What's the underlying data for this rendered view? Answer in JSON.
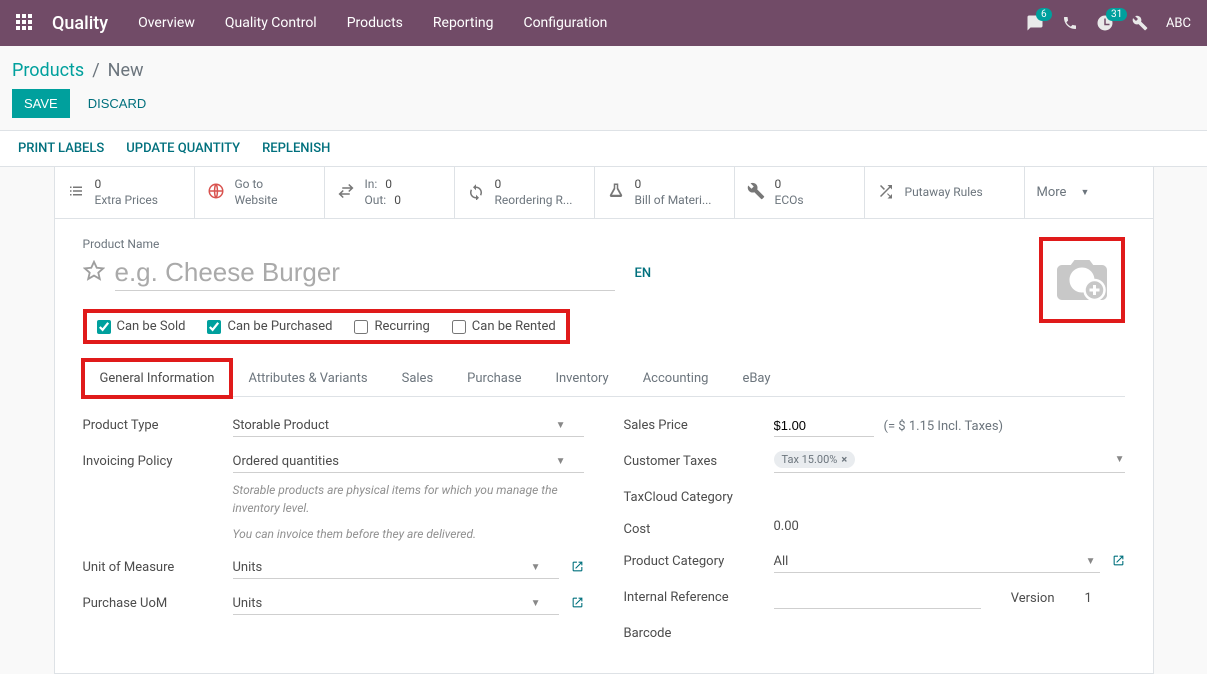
{
  "nav": {
    "brand": "Quality",
    "menu": [
      "Overview",
      "Quality Control",
      "Products",
      "Reporting",
      "Configuration"
    ],
    "chat_badge": "6",
    "clock_badge": "31",
    "user": "ABC"
  },
  "breadcrumb": {
    "parent": "Products",
    "current": "New"
  },
  "actions": {
    "save": "SAVE",
    "discard": "DISCARD"
  },
  "subactions": [
    "PRINT LABELS",
    "UPDATE QUANTITY",
    "REPLENISH"
  ],
  "stats": {
    "extra_prices": {
      "count": "0",
      "label": "Extra Prices"
    },
    "website": {
      "line1": "Go to",
      "line2": "Website"
    },
    "inout": {
      "in_label": "In:",
      "in_val": "0",
      "out_label": "Out:",
      "out_val": "0"
    },
    "reordering": {
      "count": "0",
      "label": "Reordering R..."
    },
    "bom": {
      "count": "0",
      "label": "Bill of Materi..."
    },
    "ecos": {
      "count": "0",
      "label": "ECOs"
    },
    "putaway": {
      "label": "Putaway Rules"
    },
    "more": "More"
  },
  "form": {
    "product_name_label": "Product Name",
    "product_name_placeholder": "e.g. Cheese Burger",
    "lang": "EN",
    "checks": {
      "sold": "Can be Sold",
      "purchased": "Can be Purchased",
      "recurring": "Recurring",
      "rented": "Can be Rented"
    },
    "tabs": [
      "General Information",
      "Attributes & Variants",
      "Sales",
      "Purchase",
      "Inventory",
      "Accounting",
      "eBay"
    ],
    "left": {
      "product_type_label": "Product Type",
      "product_type_value": "Storable Product",
      "invoicing_label": "Invoicing Policy",
      "invoicing_value": "Ordered quantities",
      "helper1": "Storable products are physical items for which you manage the inventory level.",
      "helper2": "You can invoice them before they are delivered.",
      "uom_label": "Unit of Measure",
      "uom_value": "Units",
      "puom_label": "Purchase UoM",
      "puom_value": "Units"
    },
    "right": {
      "sales_price_label": "Sales Price",
      "sales_price_value": "$1.00",
      "incl_taxes": "(= $ 1.15 Incl. Taxes)",
      "cust_taxes_label": "Customer Taxes",
      "tax_tag": "Tax 15.00%",
      "taxcloud_label": "TaxCloud Category",
      "cost_label": "Cost",
      "cost_value": "0.00",
      "category_label": "Product Category",
      "category_value": "All",
      "internal_ref_label": "Internal Reference",
      "version_label": "Version",
      "version_value": "1",
      "barcode_label": "Barcode"
    }
  }
}
